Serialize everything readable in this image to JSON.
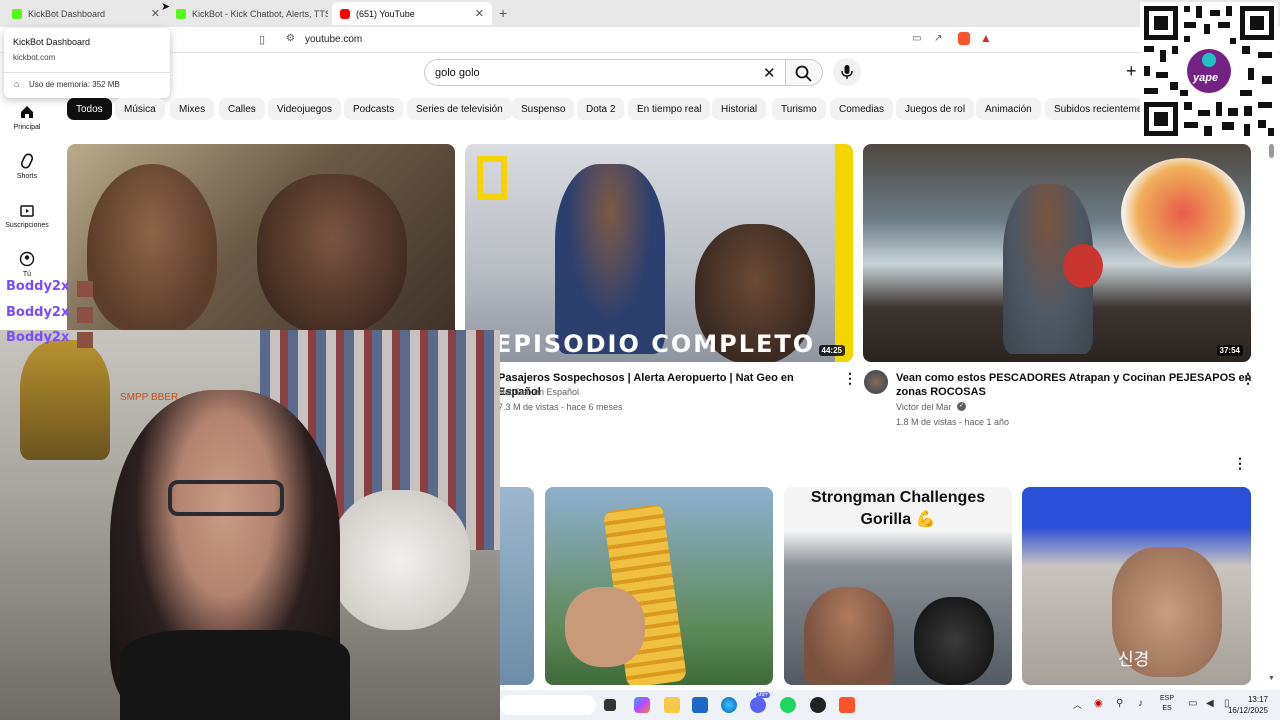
{
  "browser": {
    "tabs": [
      {
        "label": "KickBot Dashboard",
        "active": false
      },
      {
        "label": "KickBot - Kick Chatbot, Alerts, TTS, C",
        "active": false
      },
      {
        "label": "(651) YouTube",
        "active": true
      }
    ],
    "url": "youtube.com"
  },
  "tooltip": {
    "title": "KickBot Dashboard",
    "domain": "kickbot.com",
    "memory": "Uso de memoria: 352 MB"
  },
  "search": {
    "query": "golo golo"
  },
  "nav": [
    {
      "label": "Principal",
      "icon": "home-icon"
    },
    {
      "label": "Shorts",
      "icon": "shorts-icon"
    },
    {
      "label": "Suscripciones",
      "icon": "subscriptions-icon"
    },
    {
      "label": "Tú",
      "icon": "you-icon"
    }
  ],
  "chips": [
    "Todos",
    "Música",
    "Mixes",
    "Calles",
    "Videojuegos",
    "Podcasts",
    "Series de televisión",
    "Suspenso",
    "Dota 2",
    "En tiempo real",
    "Historial",
    "Turismo",
    "Comedias",
    "Juegos de rol",
    "Animación",
    "Subidos recienteme"
  ],
  "videos": [
    {
      "title": "Pasajeros Sospechosos | Alerta Aeropuerto | Nat Geo en Español",
      "channel": "Nat Geo en Español",
      "meta": "7.3 M de vistas - hace 6 meses",
      "duration": "44:25",
      "overlay": "EPISODIO COMPLETO"
    },
    {
      "title_l1": "Vean como estos PESCADORES Atrapan y Cocinan PEJESAPOS en",
      "title_l2": "zonas ROCOSAS",
      "channel": "Victor del Mar",
      "meta": "1.8 M de vistas - hace 1 año",
      "duration": "37:54"
    }
  ],
  "shorts_overlay": {
    "strongman_l1": "Strongman Challenges",
    "strongman_l2": "Gorilla 💪",
    "korean": "신경"
  },
  "webcam": {
    "chat_names": [
      "Boddy2x",
      "Boddy2x",
      "Boddy2x"
    ],
    "wall_text": "SMPP BBER"
  },
  "taskbar": {
    "badge": "99+",
    "lang_top": "ESP",
    "lang_bottom": "ES",
    "time": "13:17",
    "date": "16/12/2025"
  },
  "qr": {
    "brand": "yape"
  },
  "colors": {
    "chip_active": "#0f0f0f",
    "chat_name": "#7a4cff",
    "natgeo_yellow": "#f5d400",
    "yape_purple": "#742284"
  }
}
